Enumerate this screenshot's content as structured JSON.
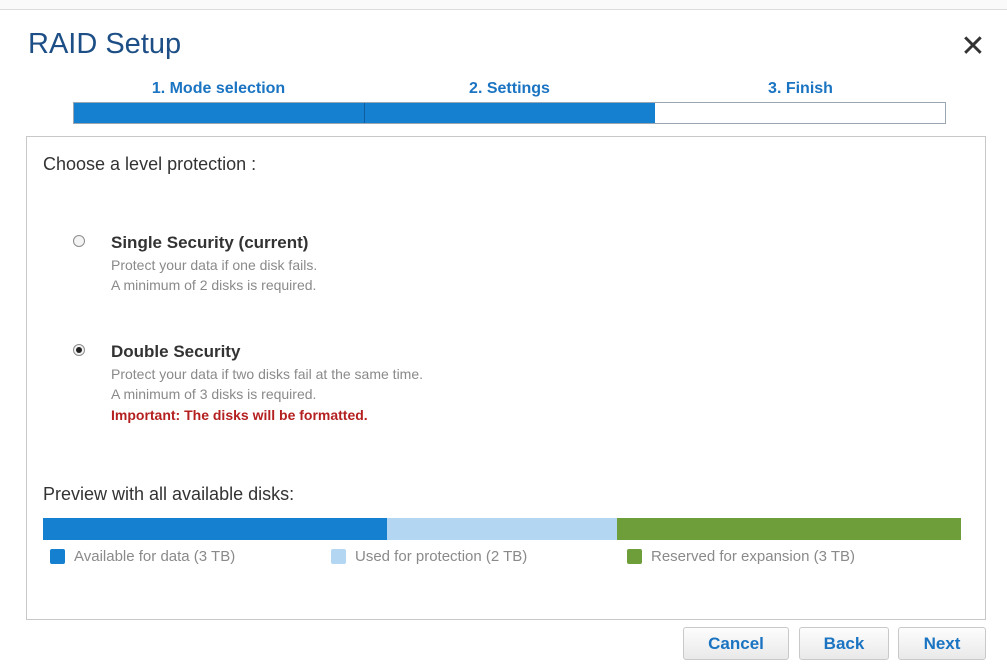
{
  "dialog": {
    "title": "RAID Setup",
    "close_icon": "close-icon"
  },
  "steps": [
    {
      "label": "1. Mode selection",
      "complete": true
    },
    {
      "label": "2. Settings",
      "complete": true
    },
    {
      "label": "3. Finish",
      "complete": false
    }
  ],
  "prompt": "Choose a level protection :",
  "options": [
    {
      "title": "Single Security (current)",
      "selected": false,
      "desc1": "Protect your data if one disk fails.",
      "desc2": "A minimum of 2 disks is required."
    },
    {
      "title": "Double Security",
      "selected": true,
      "desc1": "Protect your data if two disks fail at the same time.",
      "desc2": "A minimum of 3 disks is required.",
      "warning": "Important: The disks will be formatted."
    }
  ],
  "preview": {
    "label": "Preview with all available disks:",
    "segments": [
      {
        "legend": "Available for data (3 TB)",
        "tb": 3,
        "color": "#157fd0"
      },
      {
        "legend": "Used for protection (2 TB)",
        "tb": 2,
        "color": "#b3d7f2"
      },
      {
        "legend": "Reserved for expansion (3 TB)",
        "tb": 3,
        "color": "#6e9e3a"
      }
    ]
  },
  "buttons": {
    "cancel": "Cancel",
    "back": "Back",
    "next": "Next"
  },
  "colors": {
    "accent": "#1a74c2",
    "title": "#1d4f86",
    "warning": "#b41f1f"
  }
}
